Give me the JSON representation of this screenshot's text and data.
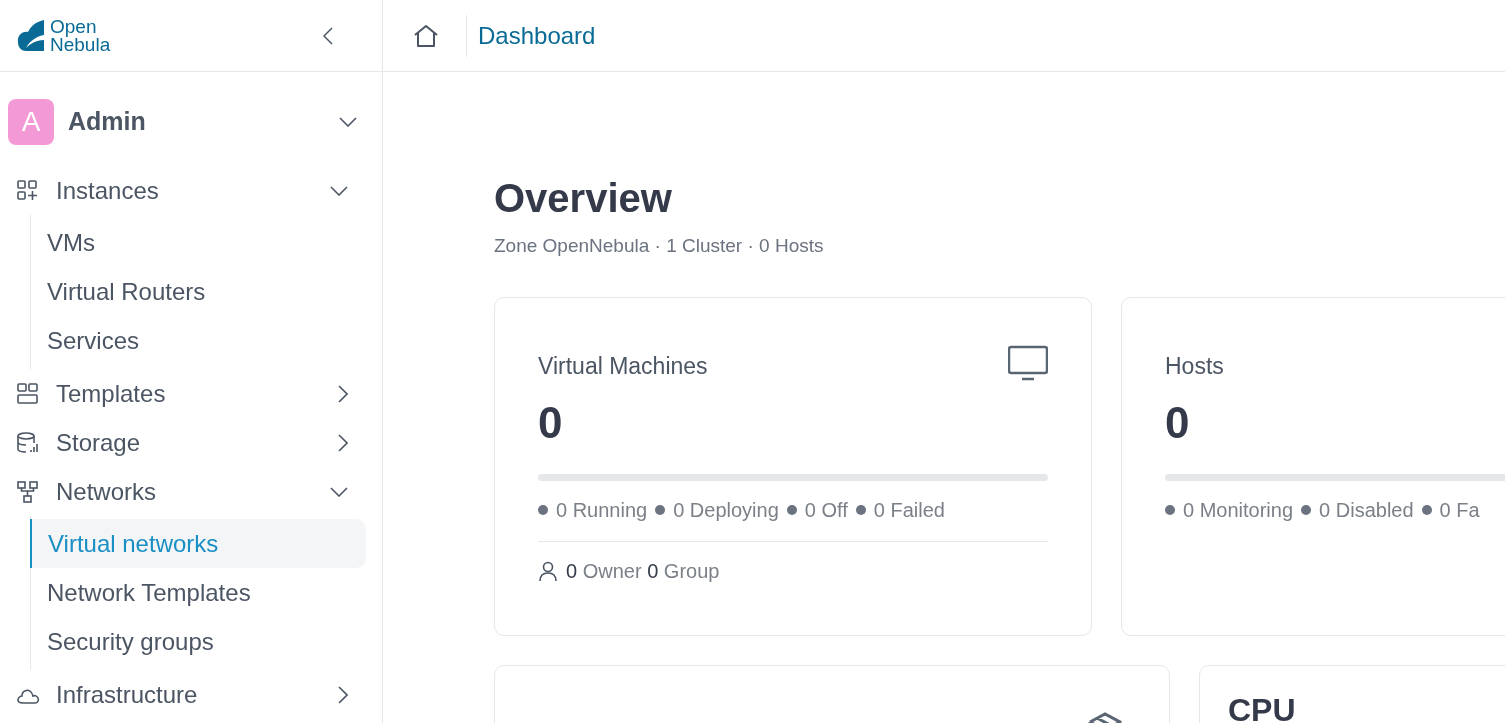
{
  "logo": {
    "line1": "Open",
    "line2": "Nebula"
  },
  "header": {
    "breadcrumb": "Dashboard"
  },
  "user": {
    "initial": "A",
    "name": "Admin"
  },
  "nav": [
    {
      "label": "Instances",
      "kind": "grid-plus",
      "expanded": true,
      "children": [
        {
          "label": "VMs",
          "selected": false
        },
        {
          "label": "Virtual Routers",
          "selected": false
        },
        {
          "label": "Services",
          "selected": false
        }
      ]
    },
    {
      "label": "Templates",
      "kind": "layout",
      "expanded": false
    },
    {
      "label": "Storage",
      "kind": "database",
      "expanded": false
    },
    {
      "label": "Networks",
      "kind": "network",
      "expanded": true,
      "children": [
        {
          "label": "Virtual networks",
          "selected": true
        },
        {
          "label": "Network Templates",
          "selected": false
        },
        {
          "label": "Security groups",
          "selected": false
        }
      ]
    },
    {
      "label": "Infrastructure",
      "kind": "cloud",
      "expanded": false
    }
  ],
  "overview": {
    "title": "Overview",
    "subtitle": "Zone OpenNebula · 1 Cluster · 0 Hosts"
  },
  "cards": [
    {
      "title": "Virtual Machines",
      "kind": "monitor",
      "value": "0",
      "level": 0,
      "stats": [
        "0 Running",
        "0 Deploying",
        "0 Off",
        "0 Failed"
      ],
      "footer": {
        "owner_count": "0",
        "owner_label": "Owner",
        "group_count": "0",
        "group_label": "Group"
      }
    },
    {
      "title": "Hosts",
      "value": "0",
      "level": 0,
      "stats": [
        "0 Monitoring",
        "0 Disabled",
        "0 Fa"
      ]
    }
  ],
  "lower_cards": [
    {
      "kind": "box"
    },
    {
      "title": "CPU"
    }
  ]
}
